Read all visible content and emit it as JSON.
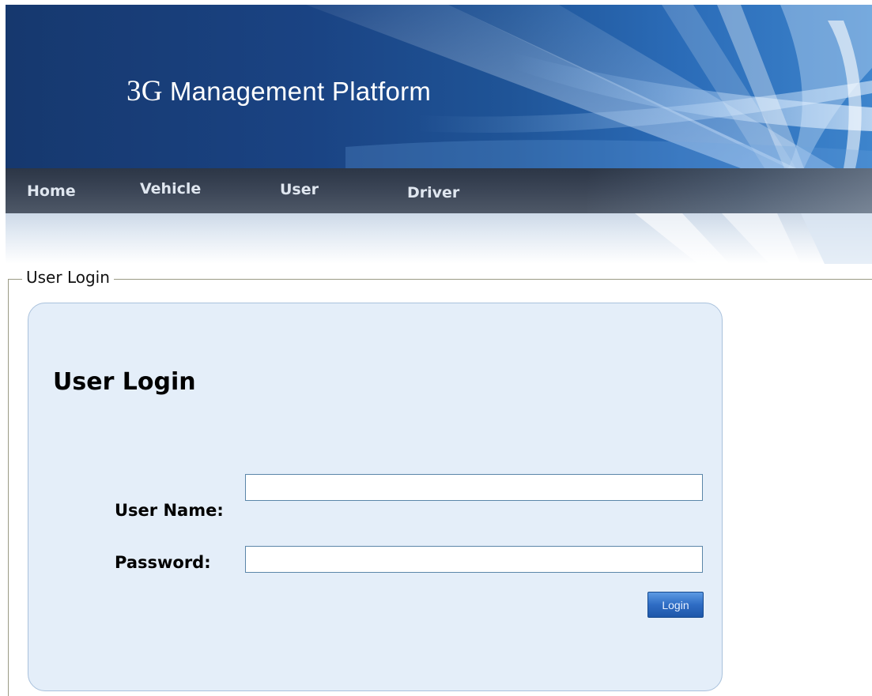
{
  "header": {
    "title_prefix": "3G",
    "title_text": "Management Platform"
  },
  "nav": {
    "items": [
      {
        "label": "Home"
      },
      {
        "label": "Vehicle"
      },
      {
        "label": "User"
      },
      {
        "label": "Driver"
      }
    ]
  },
  "fieldset": {
    "legend": "User Login"
  },
  "login": {
    "heading": "User Login",
    "username_label": "User Name:",
    "username_value": "",
    "password_label": "Password:",
    "password_value": "",
    "submit_label": "Login"
  },
  "colors": {
    "banner_dark": "#16386e",
    "banner_light": "#3d84cc",
    "nav_bg": "#3a4455",
    "panel_bg": "#e4eef9",
    "panel_border": "#a9c1dc",
    "button": "#2e6cc4"
  }
}
